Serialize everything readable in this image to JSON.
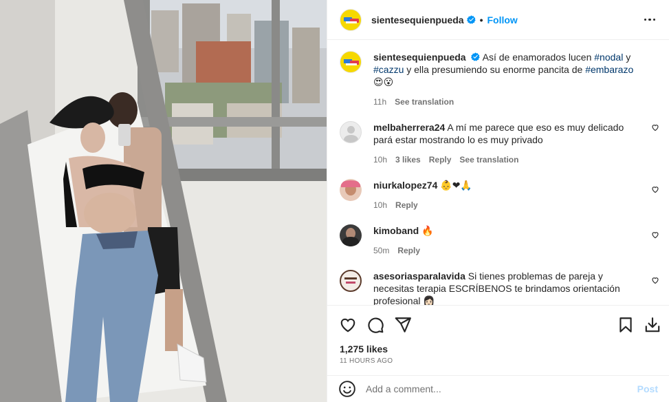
{
  "post": {
    "username": "sientesequienpueda",
    "follow_label": "Follow",
    "dot": "•"
  },
  "caption": {
    "username": "sientesequienpueda",
    "text_before": "Así de enamorados lucen ",
    "tag1": "#nodal",
    "text_mid1": " y ",
    "tag2": "#cazzu",
    "text_mid2": " y ella presumiendo su enorme pancita de ",
    "tag3": "#embarazo",
    "emojis": "😍😮",
    "time": "11h",
    "see_translation": "See translation"
  },
  "comments": [
    {
      "username": "melbaherrera24",
      "text": "A mí me parece que eso es muy delicado pará estar mostrando lo es muy privado",
      "time": "10h",
      "likes": "3 likes",
      "reply": "Reply",
      "see_translation": "See translation"
    },
    {
      "username": "niurkalopez74",
      "text": "👶❤🙏",
      "time": "10h",
      "reply": "Reply"
    },
    {
      "username": "kimoband",
      "text": "🔥",
      "time": "50m",
      "reply": "Reply"
    },
    {
      "username": "asesoriasparalavida",
      "text": "Si tienes problemas de pareja y necesitas terapia ESCRÍBENOS te brindamos orientación profesional 👩🏻"
    }
  ],
  "stats": {
    "likes": "1,275 likes",
    "ago": "11 HOURS AGO"
  },
  "composer": {
    "placeholder": "Add a comment...",
    "post_label": "Post"
  },
  "colors": {
    "link_blue": "#0095f6",
    "hashtag": "#00376b",
    "muted": "#737373",
    "verified": "#0095f6",
    "brand_yellow": "#f6d800"
  },
  "icons": [
    "verified-badge-icon",
    "more-options-icon",
    "heart-icon",
    "comment-icon",
    "share-icon",
    "bookmark-icon",
    "download-icon",
    "emoji-icon"
  ]
}
